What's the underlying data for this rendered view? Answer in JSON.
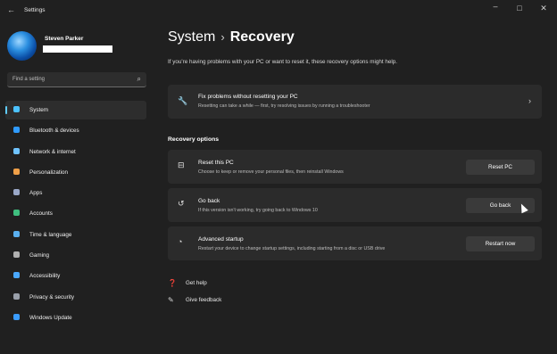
{
  "window": {
    "back_glyph": "←",
    "title": "Settings",
    "minimize_glyph": "–",
    "maximize_glyph": "□",
    "close_glyph": "✕"
  },
  "user": {
    "name": "Steven Parker"
  },
  "search": {
    "placeholder": "Find a setting",
    "icon": "search-icon"
  },
  "sidebar": {
    "items": [
      {
        "label": "System",
        "icon": "system-icon",
        "color": "#4cc2ff",
        "active": true
      },
      {
        "label": "Bluetooth & devices",
        "icon": "bluetooth-icon",
        "color": "#2f9bff"
      },
      {
        "label": "Network & internet",
        "icon": "wifi-icon",
        "color": "#6fc3ff"
      },
      {
        "label": "Personalization",
        "icon": "brush-icon",
        "color": "#f0a048"
      },
      {
        "label": "Apps",
        "icon": "apps-icon",
        "color": "#9aa8c8"
      },
      {
        "label": "Accounts",
        "icon": "person-icon",
        "color": "#3fbf7f"
      },
      {
        "label": "Time & language",
        "icon": "globe-icon",
        "color": "#5ab0f0"
      },
      {
        "label": "Gaming",
        "icon": "gamepad-icon",
        "color": "#b0b0b0"
      },
      {
        "label": "Accessibility",
        "icon": "accessibility-icon",
        "color": "#4aa8ff"
      },
      {
        "label": "Privacy & security",
        "icon": "shield-icon",
        "color": "#9aa0aa"
      },
      {
        "label": "Windows Update",
        "icon": "update-icon",
        "color": "#3a9cff"
      }
    ]
  },
  "header": {
    "section": "System",
    "separator": "›",
    "page": "Recovery"
  },
  "intro_text": "If you're having problems with your PC or want to reset it, these recovery options might help.",
  "fix_card": {
    "icon_glyph": "🔧",
    "title": "Fix problems without resetting your PC",
    "desc": "Resetting can take a while — first, try resolving issues by running a troubleshooter",
    "chevron": "›"
  },
  "recovery_section": {
    "title": "Recovery options"
  },
  "options": [
    {
      "icon_glyph": "⊟",
      "title": "Reset this PC",
      "desc": "Choose to keep or remove your personal files, then reinstall Windows",
      "button": "Reset PC"
    },
    {
      "icon_glyph": "↺",
      "title": "Go back",
      "desc": "If this version isn't working, try going back to Windows 10",
      "button": "Go back"
    },
    {
      "icon_glyph": "◔",
      "title": "Advanced startup",
      "desc": "Restart your device to change startup settings, including starting from a disc or USB drive",
      "button": "Restart now"
    }
  ],
  "links": {
    "help": {
      "icon_glyph": "❓",
      "label": "Get help"
    },
    "feedback": {
      "icon_glyph": "✎",
      "label": "Give feedback"
    }
  },
  "colors": {
    "background": "#202020",
    "card": "#2b2b2b",
    "accent": "#60cdff"
  }
}
